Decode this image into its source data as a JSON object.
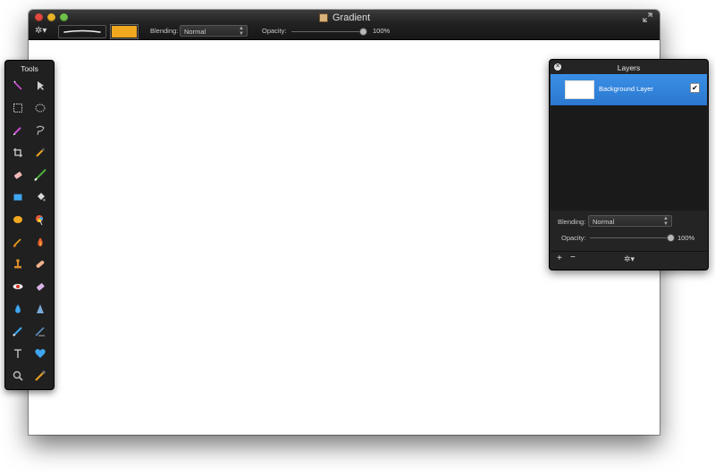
{
  "window": {
    "title": "Gradient",
    "blending_label": "Blending:",
    "blending_value": "Normal",
    "opacity_label": "Opacity:",
    "opacity_value": "100%",
    "opacity_level": 1.0,
    "primary_color": "#f0a81f"
  },
  "tools_panel": {
    "title": "Tools",
    "tools": [
      "magic-wand-icon",
      "pointer-icon",
      "rect-select-icon",
      "ellipse-select-icon",
      "lasso-pen-icon",
      "lasso-icon",
      "crop-icon",
      "eyedropper-icon",
      "eraser-icon",
      "brush-icon",
      "rectangle-shape-icon",
      "paint-bucket-icon",
      "gradient-icon",
      "color-wheel-icon",
      "smudge-icon",
      "burn-icon",
      "clone-stamp-icon",
      "bandage-icon",
      "red-eye-icon",
      "sharpen-eraser-icon",
      "blur-drop-icon",
      "cone-icon",
      "pencil-icon",
      "pen-icon",
      "text-icon",
      "heart-shape-icon",
      "zoom-icon",
      "color-picker-icon"
    ]
  },
  "layers_panel": {
    "title": "Layers",
    "layers": [
      {
        "name": "Background Layer",
        "visible": true,
        "selected": true
      }
    ],
    "blending_label": "Blending:",
    "blending_value": "Normal",
    "opacity_label": "Opacity:",
    "opacity_value": "100%",
    "opacity_level": 1.0,
    "add_label": "+",
    "remove_label": "−",
    "accent_color": "#2b78d0"
  }
}
